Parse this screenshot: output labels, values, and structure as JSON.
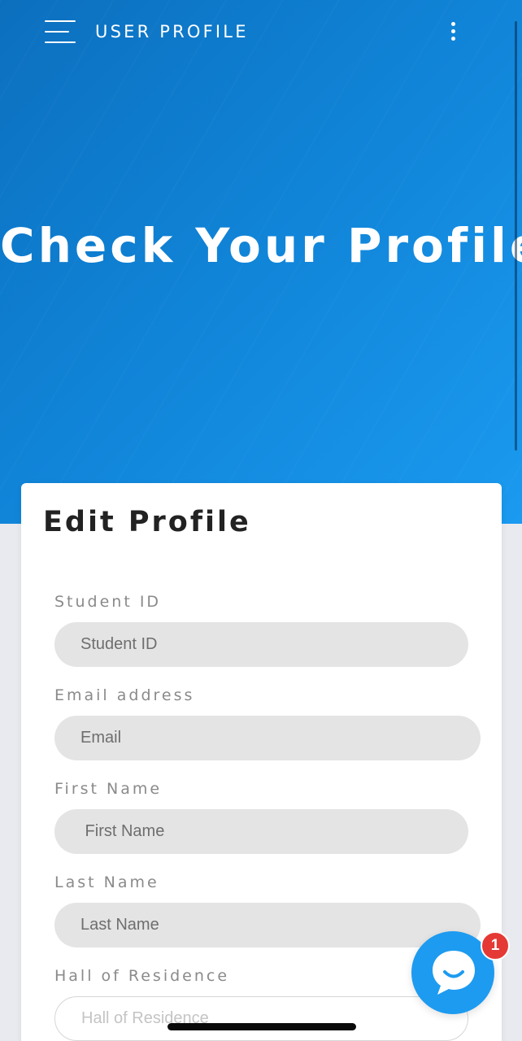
{
  "header": {
    "title": "USER PROFILE"
  },
  "hero": {
    "title": "Check Your Profile"
  },
  "form": {
    "title": "Edit Profile",
    "fields": [
      {
        "label": "Student ID",
        "placeholder": "Student ID"
      },
      {
        "label": "Email address",
        "placeholder": "Email"
      },
      {
        "label": "First Name",
        "placeholder": " First Name"
      },
      {
        "label": "Last Name",
        "placeholder": "Last Name"
      },
      {
        "label": "Hall of Residence",
        "placeholder": "Hall of Residence"
      }
    ]
  },
  "chat": {
    "badge_count": "1",
    "icon": "chat-bubble-icon"
  },
  "colors": {
    "hero_start": "#0c6fbe",
    "hero_end": "#1a9af0",
    "fab": "#1d9bf0",
    "badge": "#e53935"
  }
}
